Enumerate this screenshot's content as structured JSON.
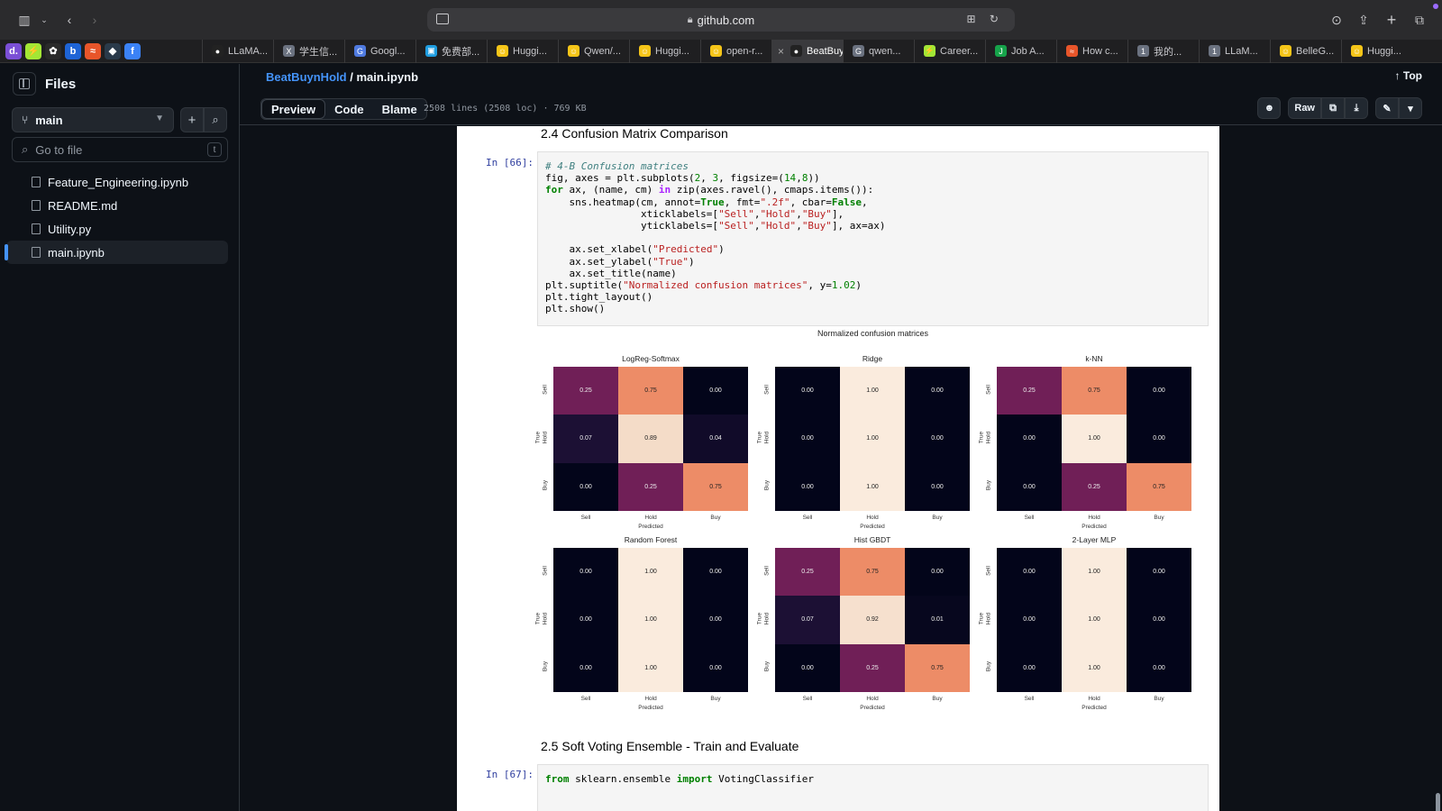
{
  "browser": {
    "url": "github.com",
    "pinned": [
      {
        "icon": "d-icon",
        "glyph": "d.",
        "color": "#7b4fd6"
      },
      {
        "icon": "lightning-icon",
        "glyph": "⚡",
        "color": "#a3e635"
      },
      {
        "icon": "nbc-icon",
        "glyph": "✿",
        "color": "#2a2a2a"
      },
      {
        "icon": "b-icon",
        "glyph": "b",
        "color": "#1e64d6"
      },
      {
        "icon": "wings-icon",
        "glyph": "≈",
        "color": "#e8552a"
      },
      {
        "icon": "bird-icon",
        "glyph": "◆",
        "color": "#2a3a4a"
      },
      {
        "icon": "f-icon",
        "glyph": "f",
        "color": "#3b82f6"
      }
    ],
    "tabs": [
      {
        "label": "LLaMA...",
        "icon": "github-icon",
        "color": "#222",
        "glyph": "●"
      },
      {
        "label": "学生信...",
        "icon": "x-icon",
        "color": "#6b7280",
        "glyph": "X"
      },
      {
        "label": "Googl...",
        "icon": "translate-icon",
        "color": "#4f7ae0",
        "glyph": "G"
      },
      {
        "label": "免费部...",
        "icon": "bilibili-icon",
        "color": "#1f9de0",
        "glyph": "▣"
      },
      {
        "label": "Huggi...",
        "icon": "huggingface-icon",
        "color": "#f5c518",
        "glyph": "☺"
      },
      {
        "label": "Qwen/...",
        "icon": "huggingface-icon",
        "color": "#f5c518",
        "glyph": "☺"
      },
      {
        "label": "Huggi...",
        "icon": "huggingface-icon",
        "color": "#f5c518",
        "glyph": "☺"
      },
      {
        "label": "open-r...",
        "icon": "huggingface-icon",
        "color": "#f5c518",
        "glyph": "☺"
      },
      {
        "label": "BeatBuynH...",
        "icon": "github-icon",
        "color": "#222",
        "glyph": "●",
        "active": true
      },
      {
        "label": "qwen...",
        "icon": "g-icon",
        "color": "#6b7280",
        "glyph": "G"
      },
      {
        "label": "Career...",
        "icon": "lightning-icon",
        "color": "#a3e635",
        "glyph": "⚡"
      },
      {
        "label": "Job A...",
        "icon": "j-icon",
        "color": "#16a34a",
        "glyph": "J"
      },
      {
        "label": "How c...",
        "icon": "wings-icon",
        "color": "#e8552a",
        "glyph": "≈"
      },
      {
        "label": "我的...",
        "icon": "one-icon",
        "color": "#6b7280",
        "glyph": "1"
      },
      {
        "label": "LLaM...",
        "icon": "one-icon",
        "color": "#6b7280",
        "glyph": "1"
      },
      {
        "label": "BelleG...",
        "icon": "huggingface-icon",
        "color": "#f5c518",
        "glyph": "☺"
      },
      {
        "label": "Huggi...",
        "icon": "huggingface-icon",
        "color": "#f5c518",
        "glyph": "☺"
      }
    ]
  },
  "sidebar": {
    "title": "Files",
    "branch": "main",
    "goto_placeholder": "Go to file",
    "goto_key": "t",
    "files": [
      {
        "name": "Feature_Engineering.ipynb",
        "active": false
      },
      {
        "name": "README.md",
        "active": false
      },
      {
        "name": "Utility.py",
        "active": false
      },
      {
        "name": "main.ipynb",
        "active": true
      }
    ]
  },
  "header": {
    "repo": "BeatBuynHold",
    "separator": "/",
    "file": "main.ipynb",
    "top_link": "Top",
    "tabs": [
      "Preview",
      "Code",
      "Blame"
    ],
    "active_tab": "Preview",
    "file_info": "2508 lines (2508 loc) · 769 KB",
    "raw_label": "Raw"
  },
  "notebook": {
    "section1_title": "2.4 Confusion Matrix Comparison",
    "cell1_prompt": "In [66]:",
    "section2_title": "2.5 Soft Voting Ensemble - Train and Evaluate",
    "cell2_prompt": "In [67]:"
  },
  "chart_data": {
    "type": "heatmap",
    "title": "Normalized confusion matrices",
    "xlabel": "Predicted",
    "ylabel": "True",
    "labels": [
      "Sell",
      "Hold",
      "Buy"
    ],
    "colormap": "rocket",
    "panels": [
      {
        "name": "LogReg-Softmax",
        "matrix": [
          [
            0.25,
            0.75,
            0.0
          ],
          [
            0.07,
            0.89,
            0.04
          ],
          [
            0.0,
            0.25,
            0.75
          ]
        ]
      },
      {
        "name": "Ridge",
        "matrix": [
          [
            0.0,
            1.0,
            0.0
          ],
          [
            0.0,
            1.0,
            0.0
          ],
          [
            0.0,
            1.0,
            0.0
          ]
        ]
      },
      {
        "name": "k-NN",
        "matrix": [
          [
            0.25,
            0.75,
            0.0
          ],
          [
            0.0,
            1.0,
            0.0
          ],
          [
            0.0,
            0.25,
            0.75
          ]
        ]
      },
      {
        "name": "Random Forest",
        "matrix": [
          [
            0.0,
            1.0,
            0.0
          ],
          [
            0.0,
            1.0,
            0.0
          ],
          [
            0.0,
            1.0,
            0.0
          ]
        ]
      },
      {
        "name": "Hist GBDT",
        "matrix": [
          [
            0.25,
            0.75,
            0.0
          ],
          [
            0.07,
            0.92,
            0.01
          ],
          [
            0.0,
            0.25,
            0.75
          ]
        ]
      },
      {
        "name": "2-Layer MLP",
        "matrix": [
          [
            0.0,
            1.0,
            0.0
          ],
          [
            0.0,
            1.0,
            0.0
          ],
          [
            0.0,
            1.0,
            0.0
          ]
        ]
      }
    ]
  }
}
